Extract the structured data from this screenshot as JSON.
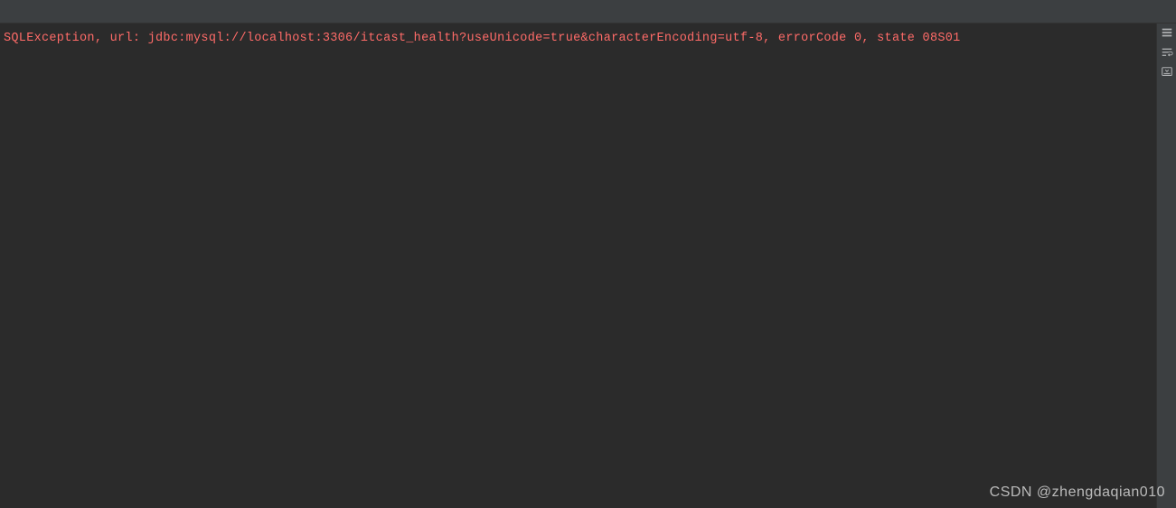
{
  "console": {
    "error_line": "SQLException, url: jdbc:mysql://localhost:3306/itcast_health?useUnicode=true&characterEncoding=utf-8, errorCode 0, state 08S01"
  },
  "watermark": {
    "text": "CSDN @zhengdaqian010"
  },
  "colors": {
    "background": "#2b2b2b",
    "header": "#3c3f41",
    "error": "#ff6b68"
  }
}
